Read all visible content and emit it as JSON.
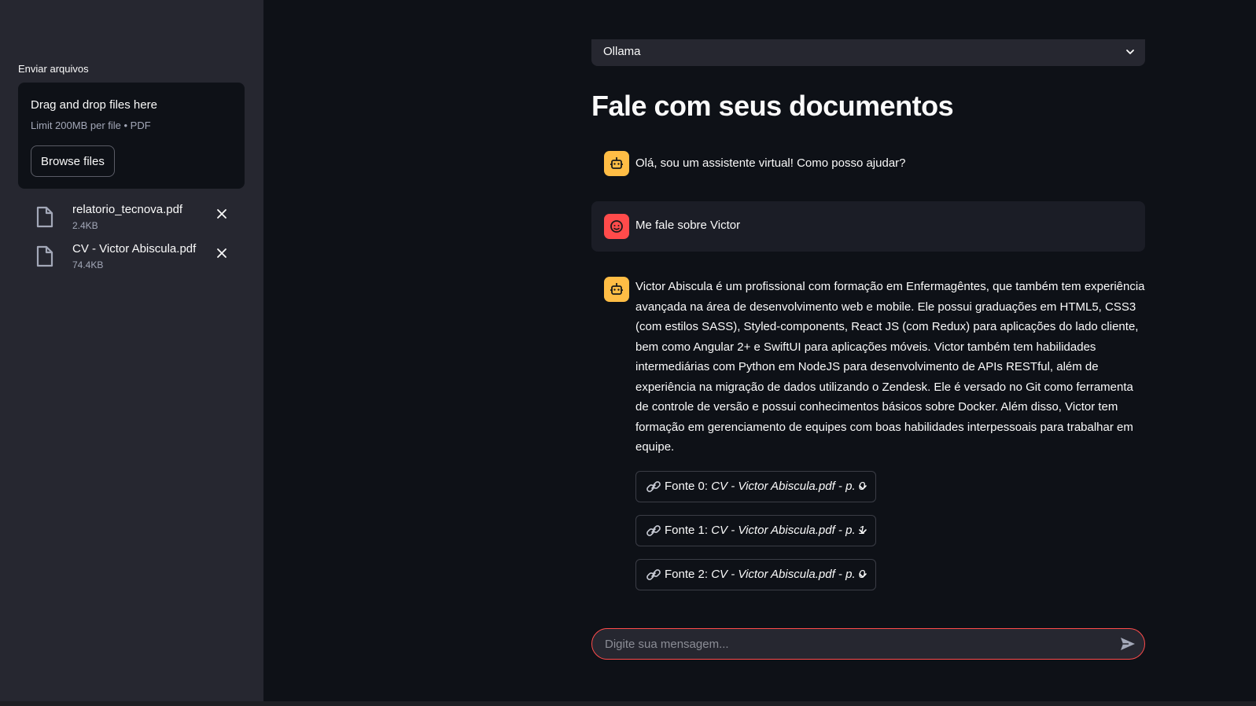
{
  "sidebar": {
    "uploader_label": "Enviar arquivos",
    "dropzone_title": "Drag and drop files here",
    "dropzone_limit": "Limit 200MB per file • PDF",
    "browse_label": "Browse files",
    "files": [
      {
        "name": "relatorio_tecnova.pdf",
        "size": "2.4KB"
      },
      {
        "name": "CV - Victor Abiscula.pdf",
        "size": "74.4KB"
      }
    ]
  },
  "main": {
    "model_select_value": "Ollama",
    "title": "Fale com seus documentos",
    "messages": [
      {
        "role": "assistant",
        "text": "Olá, sou um assistente virtual! Como posso ajudar?"
      },
      {
        "role": "user",
        "text": "Me fale sobre Victor"
      },
      {
        "role": "assistant",
        "text": "Victor Abiscula é um profissional com formação em Enfermagêntes, que também tem experiência avançada na área de desenvolvimento web e mobile. Ele possui graduações em HTML5, CSS3 (com estilos SASS), Styled-components, React JS (com Redux) para aplicações do lado cliente, bem como Angular 2+ e SwiftUI para aplicações móveis. Victor também tem habilidades intermediárias com Python em NodeJS para desenvolvimento de APIs RESTful, além de experiência na migração de dados utilizando o Zendesk. Ele é versado no Git como ferramenta de controle de versão e possui conhecimentos básicos sobre Docker. Além disso, Victor tem formação em gerenciamento de equipes com boas habilidades interpessoais para trabalhar em equipe."
      }
    ],
    "sources": [
      {
        "prefix": "Fonte 0: ",
        "doc": "CV - Victor Abiscula.pdf - p. 0"
      },
      {
        "prefix": "Fonte 1: ",
        "doc": "CV - Victor Abiscula.pdf - p. 1"
      },
      {
        "prefix": "Fonte 2: ",
        "doc": "CV - Victor Abiscula.pdf - p. 0"
      }
    ],
    "chat_placeholder": "Digite sua mensagem..."
  },
  "colors": {
    "background": "#0e1117",
    "sidebar": "#262730",
    "accent": "#ff4b4b",
    "bot_avatar": "#ffbd45"
  },
  "icons": [
    "file-icon",
    "close-icon",
    "chevron-down-icon",
    "robot-icon",
    "face-icon",
    "link-icon",
    "send-icon"
  ]
}
